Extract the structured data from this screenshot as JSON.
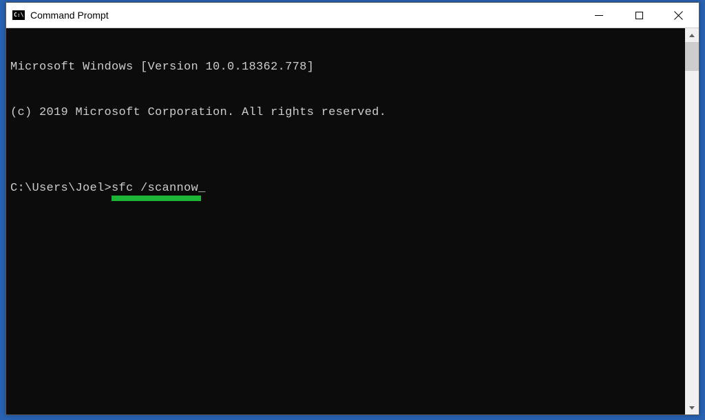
{
  "window": {
    "title": "Command Prompt",
    "icon_text": "C:\\"
  },
  "terminal": {
    "line1": "Microsoft Windows [Version 10.0.18362.778]",
    "line2": "(c) 2019 Microsoft Corporation. All rights reserved.",
    "blank": "",
    "prompt_prefix": "C:\\Users\\Joel>",
    "command": "sfc /scannow",
    "cursor": "_"
  }
}
